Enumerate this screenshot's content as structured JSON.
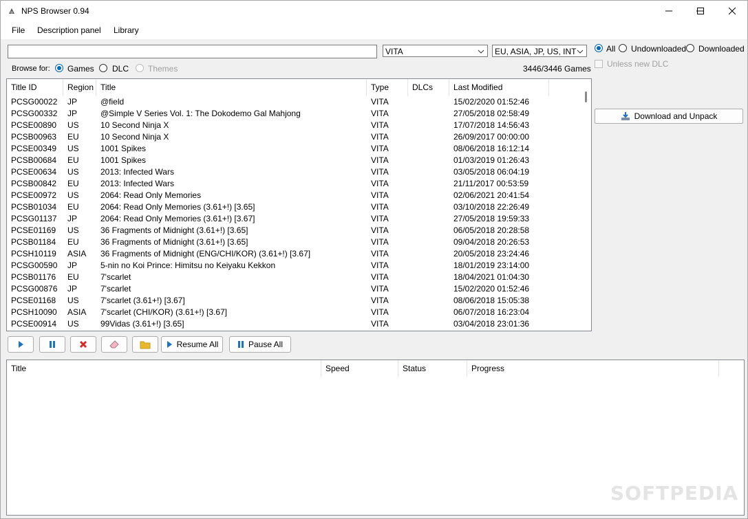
{
  "window": {
    "title": "NPS Browser 0.94"
  },
  "menu": [
    "File",
    "Description panel",
    "Library"
  ],
  "search": {
    "value": ""
  },
  "platform_combo": {
    "value": "VITA"
  },
  "region_combo": {
    "value": "EU, ASIA, JP, US, INT"
  },
  "filter": {
    "all": "All",
    "undownloaded": "Undownloaded",
    "downloaded": "Downloaded",
    "unless_new_dlc": "Unless new DLC"
  },
  "browse": {
    "label": "Browse for:",
    "games": "Games",
    "dlc": "DLC",
    "themes": "Themes"
  },
  "game_count": "3446/3446 Games",
  "columns": [
    "Title ID",
    "Region",
    "Title",
    "Type",
    "DLCs",
    "Last Modified"
  ],
  "rows": [
    [
      "PCSG00022",
      "JP",
      "@field",
      "VITA",
      "",
      "15/02/2020 01:52:46"
    ],
    [
      "PCSG00332",
      "JP",
      "@Simple V Series Vol. 1: The Dokodemo Gal Mahjong",
      "VITA",
      "",
      "27/05/2018 02:58:49"
    ],
    [
      "PCSE00890",
      "US",
      "10 Second Ninja X",
      "VITA",
      "",
      "17/07/2018 14:56:43"
    ],
    [
      "PCSB00963",
      "EU",
      "10 Second Ninja X",
      "VITA",
      "",
      "26/09/2017 00:00:00"
    ],
    [
      "PCSE00349",
      "US",
      "1001 Spikes",
      "VITA",
      "",
      "08/06/2018 16:12:14"
    ],
    [
      "PCSB00684",
      "EU",
      "1001 Spikes",
      "VITA",
      "",
      "01/03/2019 01:26:43"
    ],
    [
      "PCSE00634",
      "US",
      "2013: Infected Wars",
      "VITA",
      "",
      "03/05/2018 06:04:19"
    ],
    [
      "PCSB00842",
      "EU",
      "2013: Infected Wars",
      "VITA",
      "",
      "21/11/2017 00:53:59"
    ],
    [
      "PCSE00972",
      "US",
      "2064: Read Only Memories",
      "VITA",
      "",
      "02/06/2021 20:41:54"
    ],
    [
      "PCSB01034",
      "EU",
      "2064: Read Only Memories (3.61+!) [3.65]",
      "VITA",
      "",
      "03/10/2018 22:26:49"
    ],
    [
      "PCSG01137",
      "JP",
      "2064: Read Only Memories (3.61+!) [3.67]",
      "VITA",
      "",
      "27/05/2018 19:59:33"
    ],
    [
      "PCSE01169",
      "US",
      "36 Fragments of Midnight (3.61+!) [3.65]",
      "VITA",
      "",
      "06/05/2018 20:28:58"
    ],
    [
      "PCSB01184",
      "EU",
      "36 Fragments of Midnight (3.61+!) [3.65]",
      "VITA",
      "",
      "09/04/2018 20:26:53"
    ],
    [
      "PCSH10119",
      "ASIA",
      "36 Fragments of Midnight (ENG/CHI/KOR) (3.61+!) [3.67]",
      "VITA",
      "",
      "20/05/2018 23:24:46"
    ],
    [
      "PCSG00590",
      "JP",
      "5-nin no Koi Prince: Himitsu no Keiyaku Kekkon",
      "VITA",
      "",
      "18/01/2019 23:14:00"
    ],
    [
      "PCSB01176",
      "EU",
      "7'scarlet",
      "VITA",
      "",
      "18/04/2021 01:04:30"
    ],
    [
      "PCSG00876",
      "JP",
      "7'scarlet",
      "VITA",
      "",
      "15/02/2020 01:52:46"
    ],
    [
      "PCSE01168",
      "US",
      "7'scarlet (3.61+!) [3.67]",
      "VITA",
      "",
      "08/06/2018 15:05:38"
    ],
    [
      "PCSH10090",
      "ASIA",
      "7'scarlet (CHI/KOR) (3.61+!) [3.67]",
      "VITA",
      "",
      "06/07/2018 16:23:04"
    ],
    [
      "PCSE00914",
      "US",
      "99Vidas (3.61+!) [3.65]",
      "VITA",
      "",
      "03/04/2018 23:01:36"
    ]
  ],
  "toolbar": {
    "resume_all": "Resume All",
    "pause_all": "Pause All"
  },
  "download_button": "Download and Unpack",
  "dl_columns": [
    "Title",
    "Speed",
    "Status",
    "Progress"
  ],
  "watermark": "SOFTPEDIA",
  "colors": {
    "accent": "#0067c0",
    "play": "#1a73c8",
    "stop": "#d42a2a",
    "folder": "#e8b92c"
  }
}
